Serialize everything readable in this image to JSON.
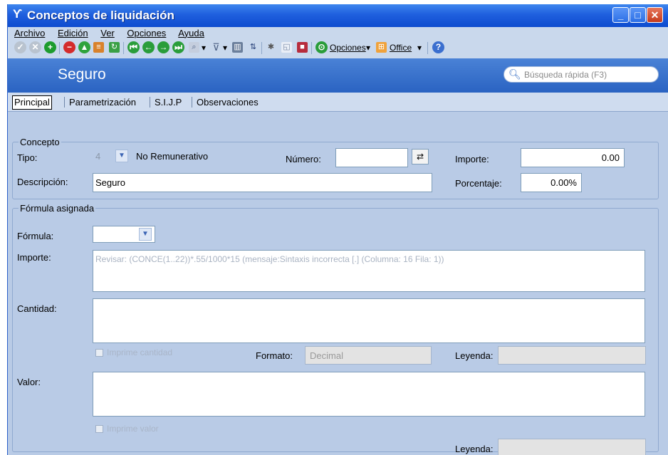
{
  "window": {
    "title": "Conceptos de liquidación",
    "app_icon": "tilde-hook-icon"
  },
  "menu": [
    "Archivo",
    "Edición",
    "Ver",
    "Opciones",
    "Ayuda"
  ],
  "toolbar": {
    "options_label": "Opciones",
    "office_label": "Office",
    "dropdown_arrow": "▾"
  },
  "header": {
    "record_title": "Seguro",
    "search_placeholder": "Búsqueda rápida (F3)"
  },
  "tabs": [
    "Principal",
    "Parametrización",
    "S.I.J.P",
    "Observaciones"
  ],
  "concepto": {
    "legend": "Concepto",
    "tipo_label": "Tipo:",
    "tipo_value": "4",
    "tipo_text": "No Remunerativo",
    "numero_label": "Número:",
    "numero_value": "",
    "importe_label": "Importe:",
    "importe_value": "0.00",
    "descripcion_label": "Descripción:",
    "descripcion_value": "Seguro",
    "porcentaje_label": "Porcentaje:",
    "porcentaje_value": "0.00%"
  },
  "formula": {
    "legend": "Fórmula asignada",
    "formula_label": "Fórmula:",
    "importe_label": "Importe:",
    "importe_text": "Revisar: (CONCE(1..22))*.55/1000*15 (mensaje:Sintaxis incorrecta [.] (Columna: 16 Fila: 1))",
    "cantidad_label": "Cantidad:",
    "imprime_cantidad": "Imprime cantidad",
    "formato_label": "Formato:",
    "formato_value": "Decimal",
    "leyenda_label": "Leyenda:",
    "valor_label": "Valor:",
    "imprime_valor": "Imprime valor",
    "leyenda2_label": "Leyenda:"
  },
  "colors": {
    "title_blue": "#1f5fde",
    "header_blue": "#2a63c2",
    "panel": "#b9cbe6"
  }
}
